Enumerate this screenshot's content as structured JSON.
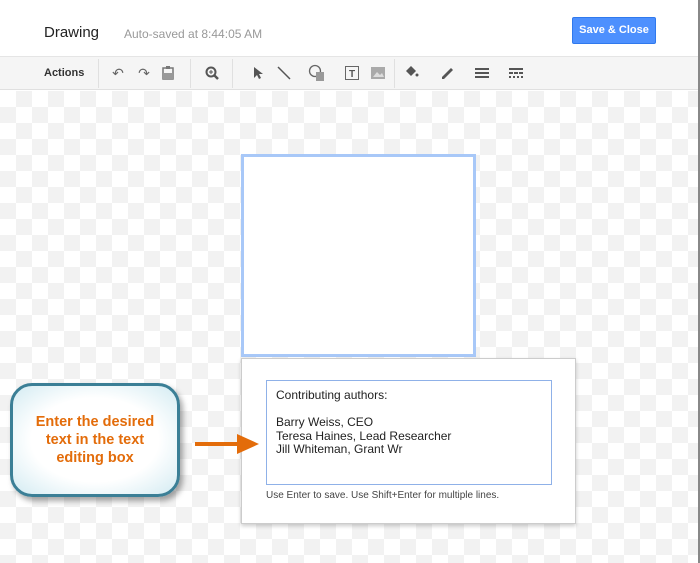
{
  "header": {
    "title": "Drawing",
    "autosave": "Auto-saved at 8:44:05 AM",
    "save_close": "Save & Close"
  },
  "toolbar": {
    "actions": "Actions",
    "icons": [
      "undo-icon",
      "redo-icon",
      "paste-format-icon",
      "zoom-icon",
      "select-icon",
      "line-icon",
      "shape-icon",
      "text-box-icon",
      "image-icon",
      "fill-color-icon",
      "line-color-icon",
      "line-weight-icon",
      "line-dash-icon"
    ]
  },
  "dialog": {
    "lines": [
      "Contributing authors:",
      "",
      "Barry Weiss, CEO",
      "Teresa Haines, Lead Researcher",
      "Jill Whiteman, Grant Wr"
    ],
    "hint": "Use Enter to save. Use Shift+Enter for multiple lines."
  },
  "callout": {
    "text": "Enter the desired text in the text editing box"
  },
  "colors": {
    "accent": "#4d90fe",
    "callout_text": "#e36c0a",
    "callout_border": "#3b7f96",
    "selection": "#a8c8f8"
  }
}
